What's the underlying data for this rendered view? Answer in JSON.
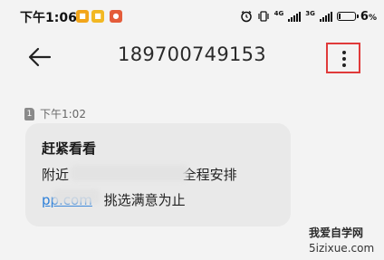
{
  "status_bar": {
    "time": "下午1:06",
    "app_icons": [
      "app-icon-1",
      "app-icon-2",
      "app-icon-3"
    ],
    "net1": "4G",
    "net2": "3G",
    "battery_percent": "6",
    "battery_suffix": "%"
  },
  "header": {
    "title": "189700749153"
  },
  "message": {
    "timestamp": "下午1:02",
    "sim_label": "1",
    "line1": "赶紧看看",
    "line2_visible_start": "附近",
    "line2_visible_end": "全程安排",
    "link_text": "pp.com",
    "line3_rest": "挑选满意为止"
  },
  "watermark": {
    "line1": "我爱自学网",
    "line2": "5izixue.com"
  },
  "colors": {
    "background": "#f3f3f3",
    "bubble": "#e9e9e9",
    "link": "#2b7fd9",
    "highlight_box": "#e03a3a"
  }
}
